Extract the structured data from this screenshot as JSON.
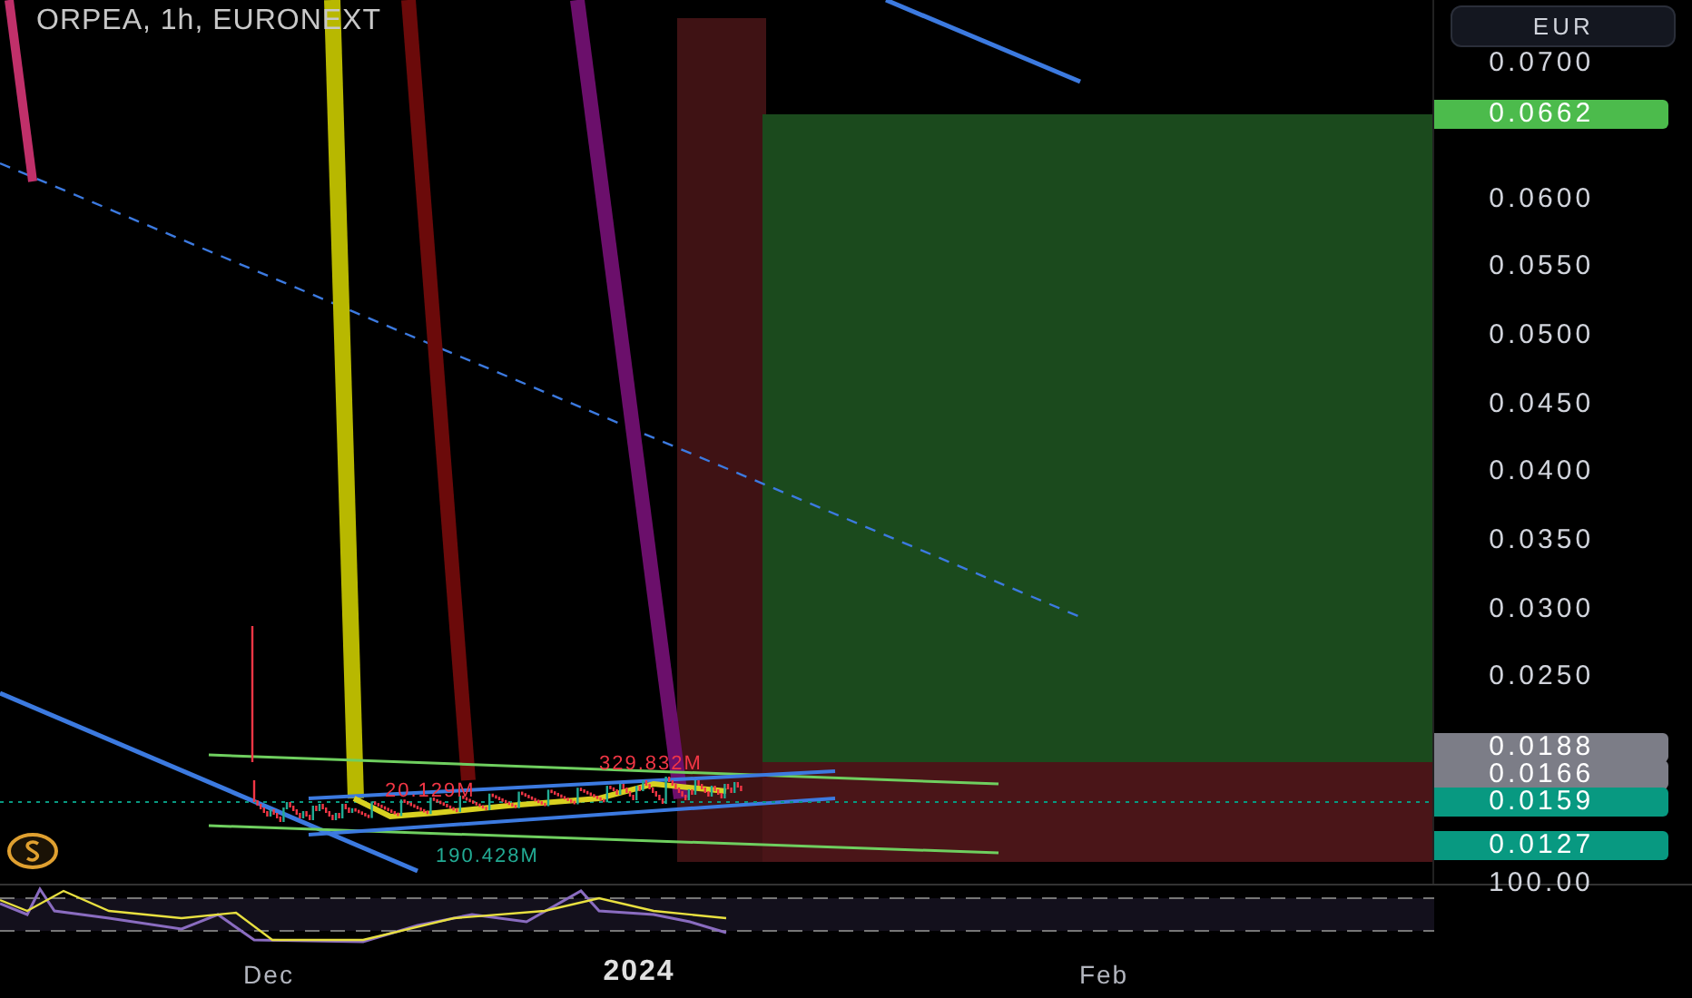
{
  "header": {
    "title": "ORPEA, 1h, EURONEXT"
  },
  "currency_button": {
    "label": "EUR"
  },
  "price_axis": {
    "ticks": [
      "0.0700",
      "0.0600",
      "0.0550",
      "0.0500",
      "0.0450",
      "0.0400",
      "0.0350",
      "0.0300",
      "0.0250"
    ],
    "tags": [
      {
        "label": "0.0662",
        "color": "#4cbb4c"
      },
      {
        "label": "0.0188",
        "color": "#7c7d87"
      },
      {
        "label": "0.0166",
        "color": "#7c7d87"
      },
      {
        "label": "0.0159",
        "color": "#089981"
      },
      {
        "label": "0.0127",
        "color": "#089981"
      }
    ]
  },
  "chart_labels": [
    {
      "label": "329.832M",
      "kind": "red"
    },
    {
      "label": "20.129M",
      "kind": "red"
    },
    {
      "label": "190.428M",
      "kind": "green"
    }
  ],
  "oscillator": {
    "axis_label": "100.00"
  },
  "time_axis": [
    "Dec",
    "2024",
    "Feb"
  ]
}
